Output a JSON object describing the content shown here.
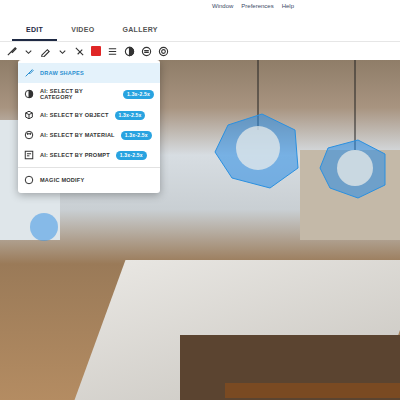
{
  "menubar": [
    "Window",
    "Preferences",
    "Help"
  ],
  "tabs": [
    {
      "label": "EDIT",
      "selected": true
    },
    {
      "label": "VIDEO",
      "selected": false
    },
    {
      "label": "GALLERY",
      "selected": false
    }
  ],
  "toolbar": {
    "color": "#e02626"
  },
  "tool_menu": {
    "items": [
      {
        "label": "DRAW SHAPES",
        "selected": true,
        "kind": "plain"
      },
      {
        "label": "AI: SELECT BY CATEGORY",
        "selected": false,
        "kind": "ai",
        "badge": "1.3x-2.5x"
      },
      {
        "label": "AI: SELECT BY OBJECT",
        "selected": false,
        "kind": "ai",
        "badge": "1.3x-2.5x"
      },
      {
        "label": "AI: SELECT BY MATERIAL",
        "selected": false,
        "kind": "ai",
        "badge": "1.3x-2.5x"
      },
      {
        "label": "AI: SELECT BY PROMPT",
        "selected": false,
        "kind": "ai",
        "badge": "1.3x-2.5x"
      },
      {
        "label": "MAGIC MODIFY",
        "selected": false,
        "kind": "magic"
      }
    ]
  }
}
